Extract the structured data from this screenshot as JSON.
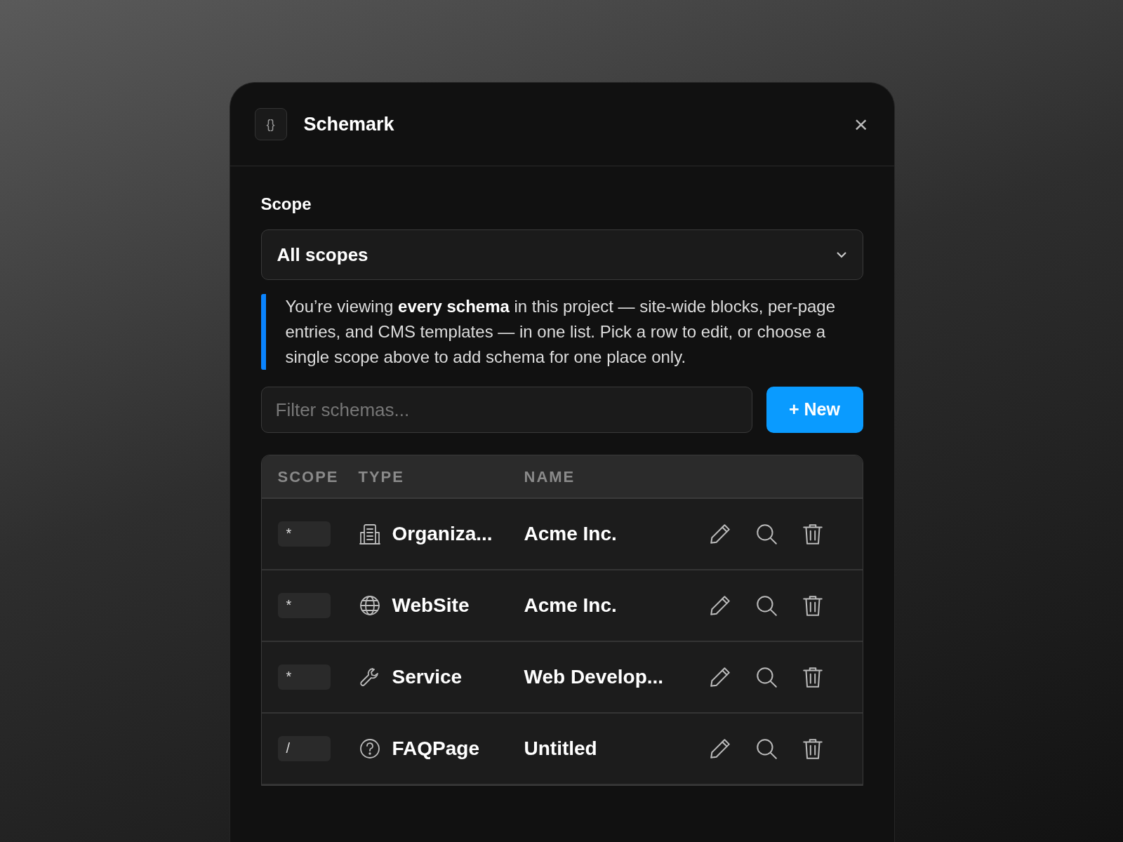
{
  "panel": {
    "title": "Schemark",
    "icon_text": "{}",
    "close": "×"
  },
  "scope": {
    "label": "Scope",
    "value": "All scopes"
  },
  "info": "You’re viewing **every schema** in this project — site-wide blocks, per-page entries, and CMS templates — in one list. Pick a row to edit, or choose a single scope above to add schema for one place only.",
  "filter": {
    "placeholder": "Filter schemas..."
  },
  "new_button": "+ New",
  "table": {
    "columns": [
      "SCOPE",
      "TYPE",
      "NAME"
    ],
    "rows": [
      {
        "scope": "*",
        "kind": "building",
        "type": "Organiza...",
        "name": "Acme Inc."
      },
      {
        "scope": "*",
        "kind": "globe",
        "type": "WebSite",
        "name": "Acme Inc."
      },
      {
        "scope": "*",
        "kind": "wrench",
        "type": "Service",
        "name": "Web Develop..."
      },
      {
        "scope": "/",
        "kind": "question",
        "type": "FAQPage",
        "name": "Untitled"
      }
    ]
  }
}
